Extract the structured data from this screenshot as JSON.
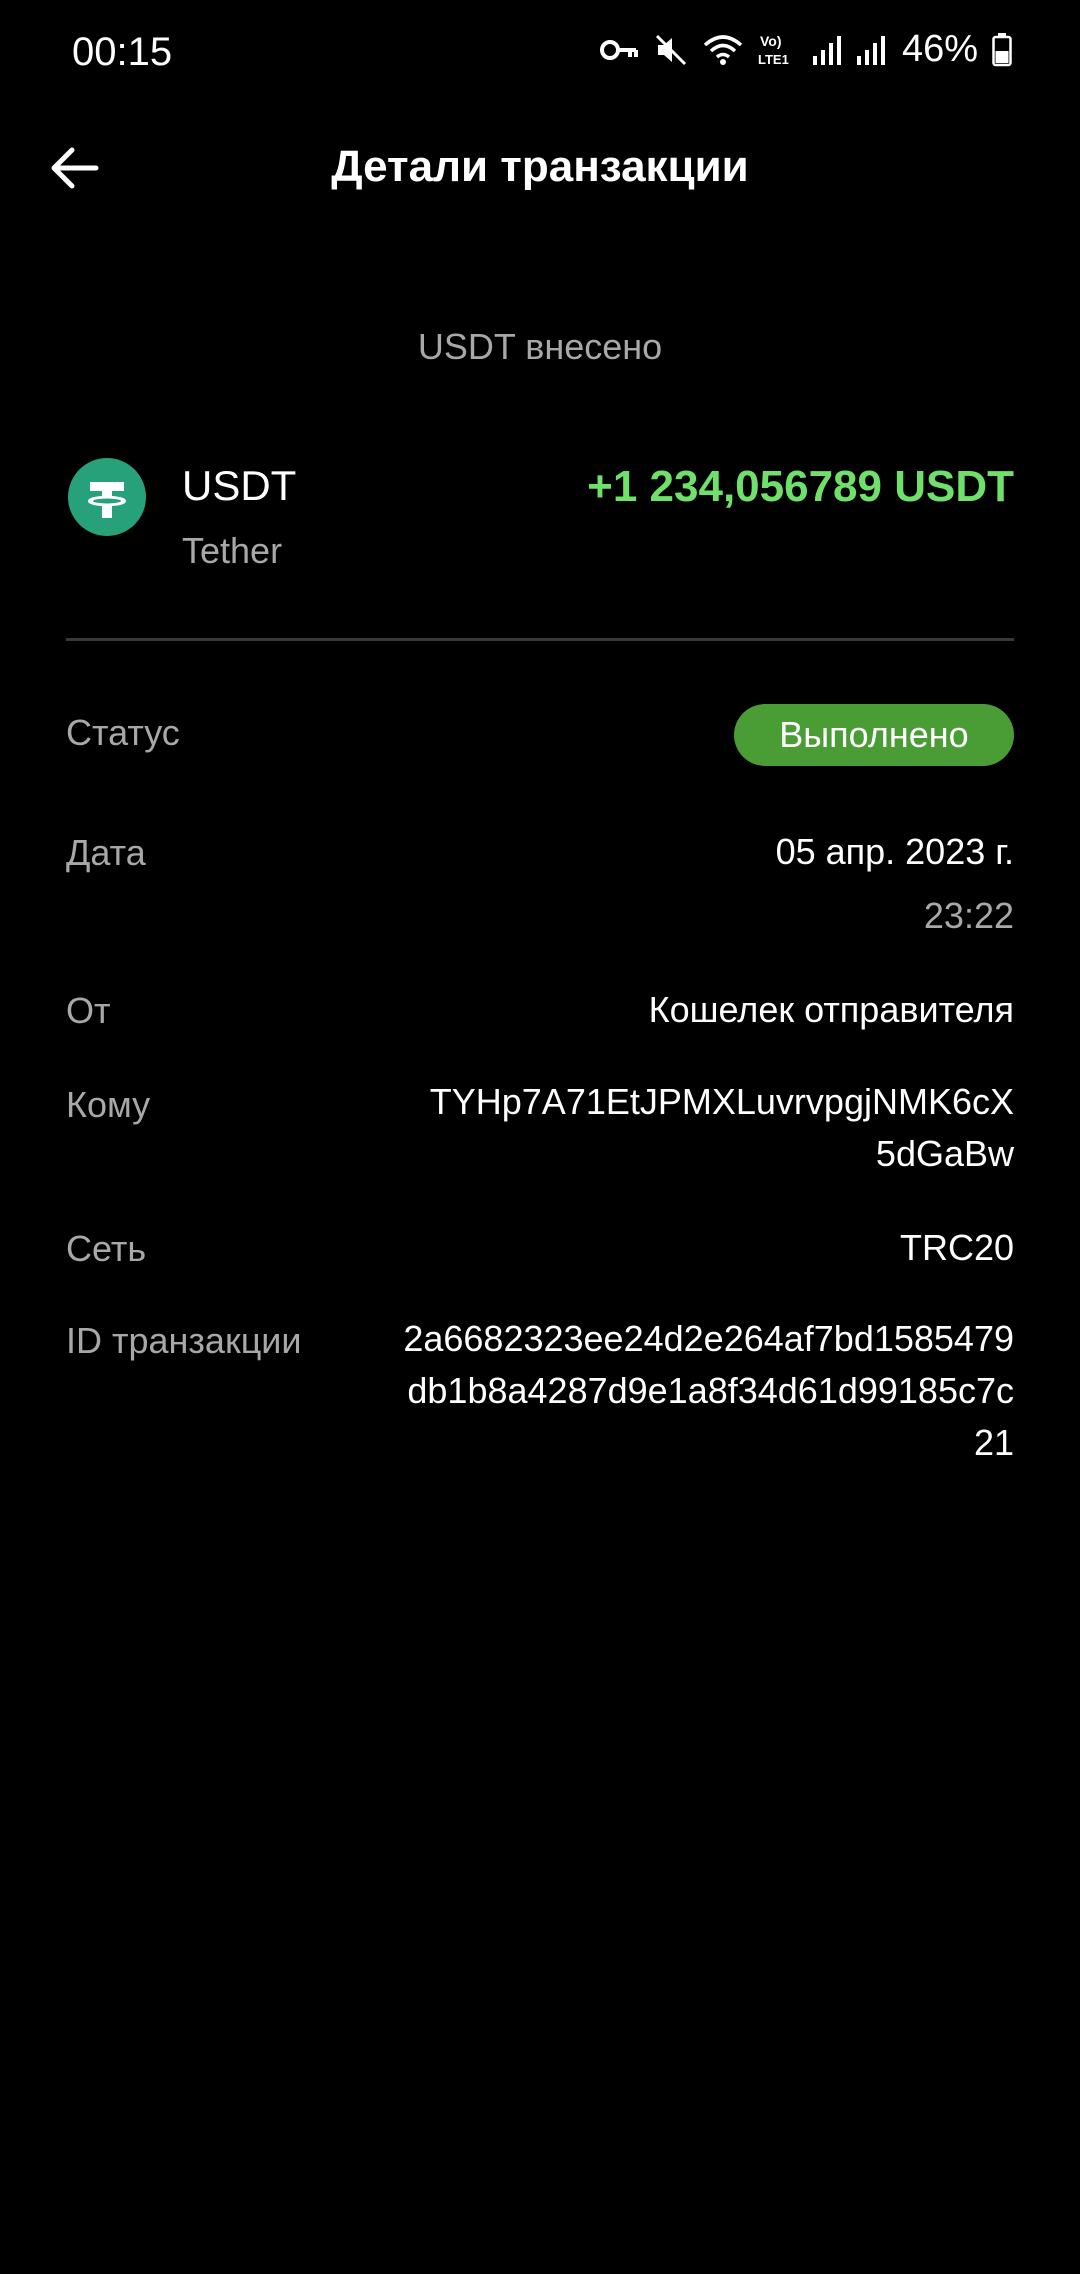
{
  "status_bar": {
    "time": "00:15",
    "battery": "46%",
    "network_label": "Vo) LTE1",
    "icons": [
      "key-icon",
      "mute-icon",
      "wifi-icon",
      "volte-icon",
      "signal-icon",
      "signal-icon",
      "battery-icon"
    ]
  },
  "header": {
    "title": "Детали транзакции",
    "back_icon": "arrow-left-icon"
  },
  "subtitle": "USDT внесено",
  "asset": {
    "symbol": "USDT",
    "name": "Tether",
    "amount": "+1 234,056789 USDT",
    "icon": "tether-icon",
    "icon_color": "#27a17a",
    "amount_color": "#6fe06a"
  },
  "details": {
    "status_label": "Статус",
    "status_value": "Выполнено",
    "status_color": "#4a9c34",
    "date_label": "Дата",
    "date_value": "05 апр. 2023 г.",
    "time_value": "23:22",
    "from_label": "От",
    "from_value": "Кошелек отправителя",
    "to_label": "Кому",
    "to_value": "TYHp7A71EtJPMXLuvrvpgjNMK6cX5dGaBw",
    "network_label": "Сеть",
    "network_value": "TRC20",
    "txid_label": "ID транзакции",
    "txid_value": "2a6682323ee24d2e264af7bd1585479db1b8a4287d9e1a8f34d61d99185c7c21"
  }
}
